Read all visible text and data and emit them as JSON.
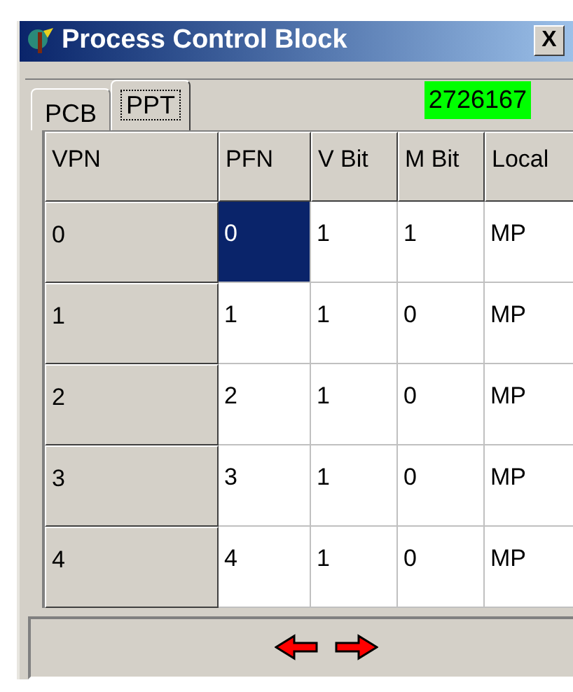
{
  "window": {
    "title": "Process Control Block",
    "close": "X"
  },
  "tabs": [
    {
      "label": "PCB",
      "selected": false
    },
    {
      "label": "PPT",
      "selected": true
    }
  ],
  "counter": "2726167",
  "table": {
    "columns": [
      "VPN",
      "PFN",
      "V Bit",
      "M Bit",
      "Local"
    ],
    "rows": [
      {
        "cells": [
          {
            "text": "0",
            "selected": false
          },
          {
            "text": "0",
            "selected": true
          },
          {
            "text": "1",
            "selected": false
          },
          {
            "text": "1",
            "selected": false
          },
          {
            "text": "MP",
            "selected": false
          }
        ]
      },
      {
        "cells": [
          {
            "text": "1",
            "selected": false
          },
          {
            "text": "1",
            "selected": false
          },
          {
            "text": "1",
            "selected": false
          },
          {
            "text": "0",
            "selected": false
          },
          {
            "text": "MP",
            "selected": false
          }
        ]
      },
      {
        "cells": [
          {
            "text": "2",
            "selected": false
          },
          {
            "text": "2",
            "selected": false
          },
          {
            "text": "1",
            "selected": false
          },
          {
            "text": "0",
            "selected": false
          },
          {
            "text": "MP",
            "selected": false
          }
        ]
      },
      {
        "cells": [
          {
            "text": "3",
            "selected": false
          },
          {
            "text": "3",
            "selected": false
          },
          {
            "text": "1",
            "selected": false
          },
          {
            "text": "0",
            "selected": false
          },
          {
            "text": "MP",
            "selected": false
          }
        ]
      },
      {
        "cells": [
          {
            "text": "4",
            "selected": false
          },
          {
            "text": "4",
            "selected": false
          },
          {
            "text": "1",
            "selected": false
          },
          {
            "text": "0",
            "selected": false
          },
          {
            "text": "MP",
            "selected": false
          }
        ]
      }
    ]
  }
}
